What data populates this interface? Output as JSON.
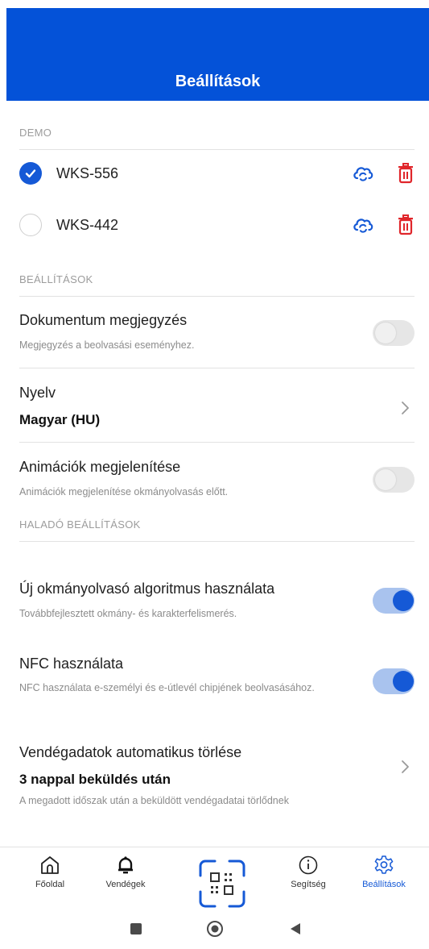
{
  "header": {
    "title": "Beállítások"
  },
  "demo": {
    "section_label": "DEMO",
    "devices": [
      {
        "name": "WKS-556",
        "selected": true,
        "upload_icon": "cloud-sync-icon",
        "delete_icon": "trash-icon"
      },
      {
        "name": "WKS-442",
        "selected": false,
        "upload_icon": "cloud-sync-icon",
        "delete_icon": "trash-icon"
      }
    ]
  },
  "settings": {
    "section_label": "BEÁLLÍTÁSOK",
    "document_note": {
      "title": "Dokumentum megjegyzés",
      "subtitle": "Megjegyzés a beolvasási eseményhez.",
      "enabled": false
    },
    "language": {
      "title": "Nyelv",
      "value": "Magyar (HU)"
    },
    "animations": {
      "title": "Animációk megjelenítése",
      "subtitle": "Animációk megjelenítése okmányolvasás előtt.",
      "enabled": false
    }
  },
  "advanced": {
    "section_label": "HALADÓ BEÁLLÍTÁSOK",
    "new_algorithm": {
      "title": "Új okmányolvasó algoritmus használata",
      "subtitle": "Továbbfejlesztett okmány- és karakterfelismerés.",
      "enabled": true
    },
    "nfc": {
      "title": "NFC használata",
      "subtitle": "NFC használata e-személyi és e-útlevél chipjének beolvasásához.",
      "enabled": true
    },
    "guest_delete": {
      "title": "Vendégadatok automatikus törlése",
      "value": "3 nappal beküldés után",
      "subtitle": "A megadott időszak után a beküldött vendégadatai törlődnek"
    }
  },
  "bottom_nav": {
    "items": [
      {
        "label": "Főoldal",
        "icon": "home-icon"
      },
      {
        "label": "Vendégek",
        "icon": "bell-icon"
      },
      {
        "label": "",
        "icon": "qr-scan-icon"
      },
      {
        "label": "Segítség",
        "icon": "info-icon"
      },
      {
        "label": "Beállítások",
        "icon": "gear-icon",
        "active": true
      }
    ]
  },
  "colors": {
    "primary": "#0452d8",
    "accent": "#1559d6",
    "danger": "#e0262b"
  }
}
